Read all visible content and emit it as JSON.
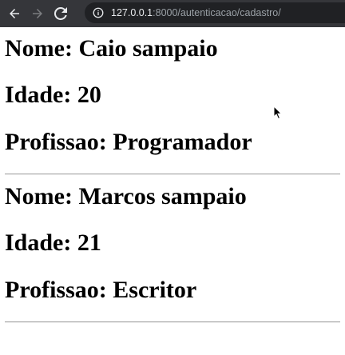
{
  "browser": {
    "url_host": "127.0.0.1",
    "url_path": ":8000/autenticacao/cadastro/",
    "icons": {
      "back": "arrow-left-icon",
      "forward": "arrow-right-icon",
      "reload": "reload-icon",
      "info": "info-icon"
    }
  },
  "people": [
    {
      "nome": "Nome: Caio sampaio",
      "idade": "Idade: 20",
      "profissao": "Profissao: Programador"
    },
    {
      "nome": "Nome: Marcos sampaio",
      "idade": "Idade: 21",
      "profissao": "Profissao: Escritor"
    }
  ]
}
